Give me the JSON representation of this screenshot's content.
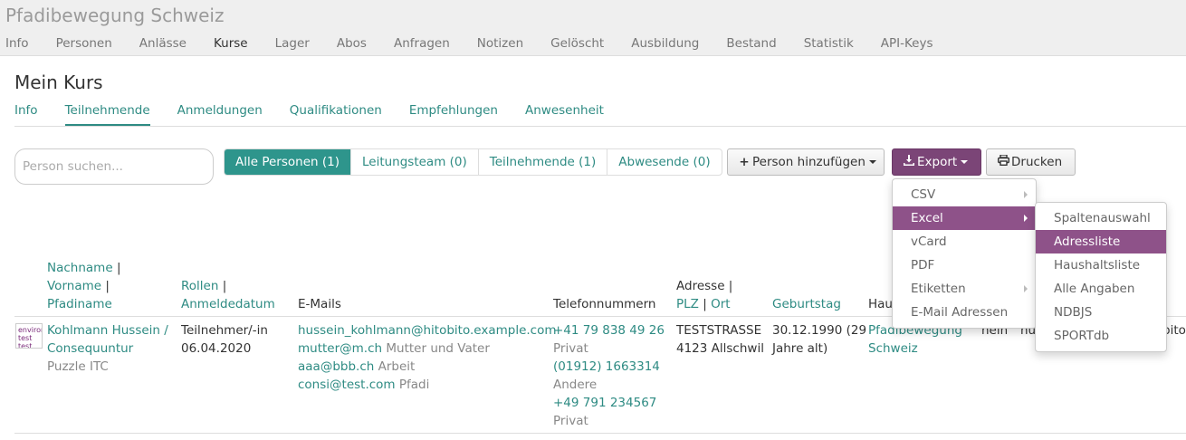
{
  "app": {
    "brand": "Pfadibewegung Schweiz",
    "nav": [
      "Info",
      "Personen",
      "Anlässe",
      "Kurse",
      "Lager",
      "Abos",
      "Anfragen",
      "Notizen",
      "Gelöscht",
      "Ausbildung",
      "Bestand",
      "Statistik",
      "API-Keys"
    ],
    "nav_active": "Kurse"
  },
  "page": {
    "title": "Mein Kurs",
    "tabs": [
      "Info",
      "Teilnehmende",
      "Anmeldungen",
      "Qualifikationen",
      "Empfehlungen",
      "Anwesenheit"
    ],
    "tab_active": "Teilnehmende"
  },
  "toolbar": {
    "search_placeholder": "Person suchen...",
    "filters": [
      "Alle Personen (1)",
      "Leitungsteam (0)",
      "Teilnehmende (1)",
      "Abwesende (0)"
    ],
    "add_label": "Person hinzufügen",
    "export_label": "Export",
    "print_label": "Drucken"
  },
  "export_menu": {
    "items": [
      "CSV",
      "Excel",
      "vCard",
      "PDF",
      "Etiketten",
      "E-Mail Adressen"
    ],
    "highlighted": "Excel"
  },
  "excel_submenu": {
    "items": [
      "Spaltenauswahl",
      "Adressliste",
      "Haushaltsliste",
      "Alle Angaben",
      "NDBJS",
      "SPORTdb"
    ],
    "highlighted": "Adressliste"
  },
  "table": {
    "headers": {
      "name": [
        "Nachname",
        "Vorname",
        "Pfadiname"
      ],
      "roles": [
        "Rollen",
        "Anmeldedatum"
      ],
      "emails": "E-Mails",
      "phones": "Telefonnummern",
      "address": [
        "Adresse",
        "PLZ",
        "Ort"
      ],
      "birthday": "Geburtstag",
      "household": "Hau"
    },
    "row": {
      "avatar_text": "environ test test",
      "name_line1": "Kohlmann Hussein /",
      "name_line2": "Consequuntur",
      "pfadiname": "Puzzle ITC",
      "role": "Teilnehmer/-in",
      "date": "06.04.2020",
      "emails": [
        {
          "address": "hussein_kohlmann@hitobito.example.com",
          "label": ""
        },
        {
          "address": "mutter@m.ch",
          "label": "Mutter und Vater"
        },
        {
          "address": "aaa@bbb.ch",
          "label": "Arbeit"
        },
        {
          "address": "consi@test.com",
          "label": "Pfadi"
        }
      ],
      "phones": [
        {
          "number": "+41 79 838 49 26",
          "label": "Privat"
        },
        {
          "number": "(01912) 1663314",
          "label": "Andere"
        },
        {
          "number": "+49 791 234567",
          "label": "Privat"
        }
      ],
      "street": "TESTSTRASSE",
      "city": "4123 Allschwil",
      "birthday_line1": "30.12.1990 (29",
      "birthday_line2": "Jahre alt)",
      "group_line1": "Pfadibewegung",
      "group_line2": "Schweiz",
      "extra1": "nein",
      "extra2": "hu",
      "extra3": "bito"
    }
  }
}
